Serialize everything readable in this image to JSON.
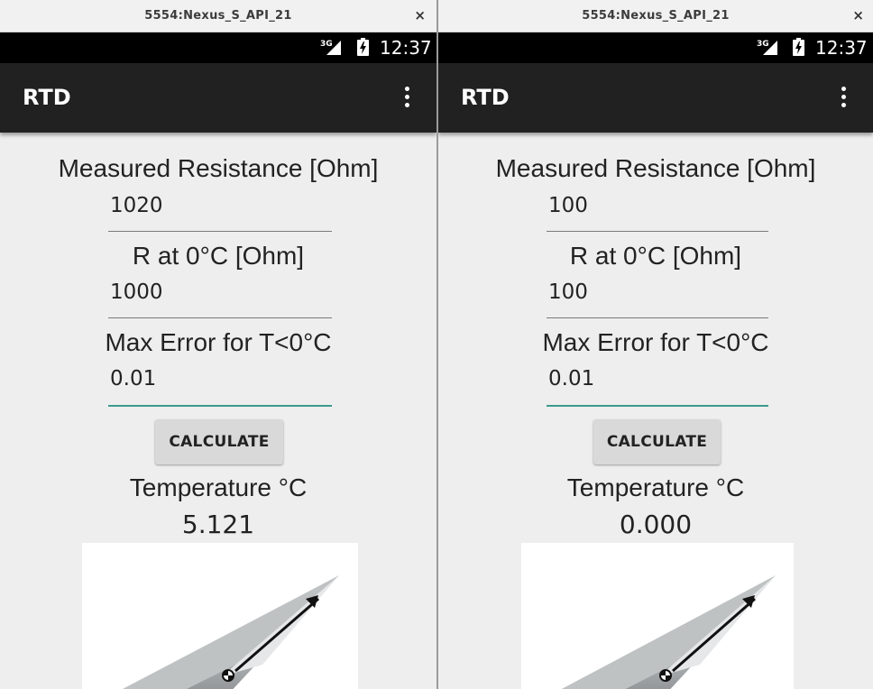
{
  "windows": [
    {
      "window_title": "5554:Nexus_S_API_21",
      "close_glyph": "×",
      "status": {
        "network": "3G",
        "time": "12:37"
      },
      "app_title": "RTD",
      "measured_label": "Measured Resistance [Ohm]",
      "measured_value": "1020",
      "r0_label": "R at 0°C [Ohm]",
      "r0_value": "1000",
      "maxerr_label": "Max Error for T<0°C",
      "maxerr_value": "0.01",
      "button_label": "CALCULATE",
      "temp_label": "Temperature °C",
      "temp_value": "5.121"
    },
    {
      "window_title": "5554:Nexus_S_API_21",
      "close_glyph": "×",
      "status": {
        "network": "3G",
        "time": "12:37"
      },
      "app_title": "RTD",
      "measured_label": "Measured Resistance [Ohm]",
      "measured_value": "100",
      "r0_label": "R at 0°C [Ohm]",
      "r0_value": "100",
      "maxerr_label": "Max Error for T<0°C",
      "maxerr_value": "0.01",
      "button_label": "CALCULATE",
      "temp_label": "Temperature °C",
      "temp_value": "0.000"
    }
  ],
  "icons": {
    "close": "close-icon",
    "signal": "signal-3g-icon",
    "battery": "battery-charging-icon",
    "overflow": "overflow-menu-icon"
  },
  "colors": {
    "action_bar": "#212121",
    "status_bar": "#000000",
    "background": "#eeeeee",
    "accent_underline": "#3a9a8f",
    "button": "#d9d9d9"
  }
}
